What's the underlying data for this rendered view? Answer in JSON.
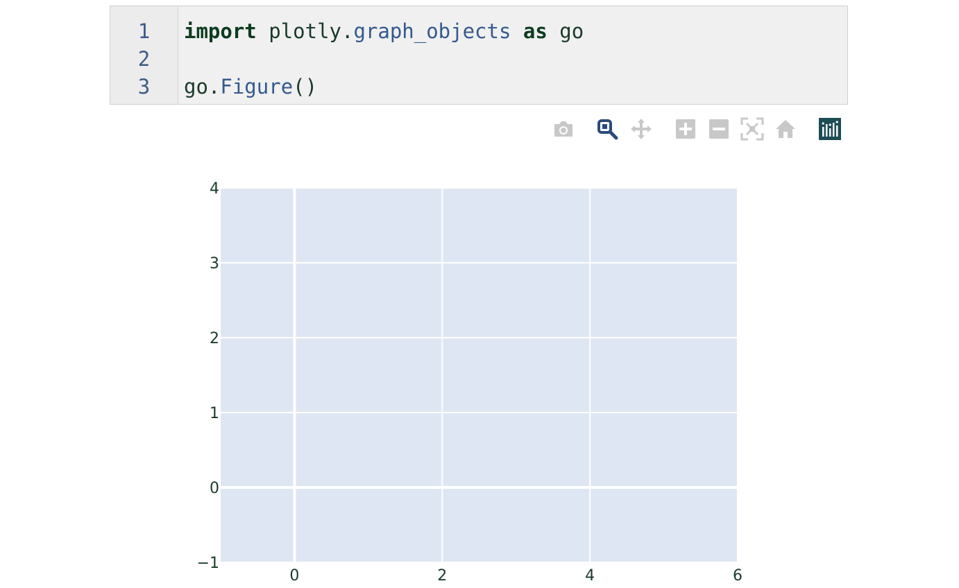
{
  "code_cell": {
    "line_numbers": [
      "1",
      "2",
      "3"
    ],
    "line1": {
      "kw_import": "import",
      "module_a": "plotly.",
      "module_b": "graph_objects",
      "kw_as": "as",
      "alias": "go"
    },
    "line3": {
      "obj": "go.",
      "call": "Figure",
      "parens": "()"
    }
  },
  "modebar": {
    "icons": [
      "camera-icon",
      "zoom-icon",
      "pan-icon",
      "zoom-in-icon",
      "zoom-out-icon",
      "autoscale-icon",
      "reset-axes-icon",
      "plotly-logo-icon"
    ],
    "active": "zoom",
    "colors": {
      "inactive": "#c8c8c8",
      "active": "#2c4a7a",
      "logo": "#1d4d55"
    }
  },
  "chart_data": {
    "type": "scatter",
    "title": "",
    "xlabel": "",
    "ylabel": "",
    "xlim": [
      -1,
      6
    ],
    "ylim": [
      -1,
      4
    ],
    "x_ticks": [
      "0",
      "2",
      "4",
      "6"
    ],
    "y_ticks": [
      "4",
      "3",
      "2",
      "1",
      "0",
      "−1"
    ],
    "series": [],
    "grid": true,
    "plot_bgcolor": "#dfe6f3"
  }
}
